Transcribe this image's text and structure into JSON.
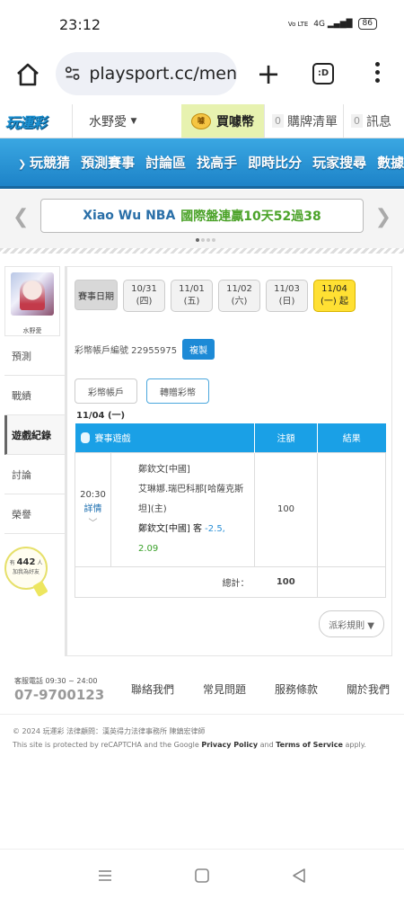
{
  "status": {
    "time": "23:12",
    "net": "Vo LTE",
    "signal": "4G",
    "battery": "86"
  },
  "browser": {
    "url": "playsport.cc/men",
    "tabs_label": ":D"
  },
  "site": {
    "logo": "玩運彩",
    "user": "水野愛",
    "buy_coin": "買噱幣",
    "coin_icon_text": "噱",
    "cart_count": "0",
    "cart_label": "購牌清單",
    "msg_count": "0",
    "msg_label": "訊息"
  },
  "nav": {
    "items": [
      "玩競猜",
      "預測賽事",
      "討論區",
      "找高手",
      "即時比分",
      "玩家搜尋",
      "數據"
    ]
  },
  "banner": {
    "left_text": "Xiao Wu NBA",
    "right_text": "國際盤連贏10天52過38"
  },
  "sidebar": {
    "username": "水野愛",
    "items": [
      "預測",
      "戰績",
      "遊戲紀錄",
      "討論",
      "榮譽"
    ],
    "hint_pre": "有",
    "hint_num": "442",
    "hint_post": "人",
    "hint_line2": "加我為好友"
  },
  "main": {
    "date_label": "賽事日期",
    "dates": [
      {
        "d": "10/31",
        "w": "(四)"
      },
      {
        "d": "11/01",
        "w": "(五)"
      },
      {
        "d": "11/02",
        "w": "(六)"
      },
      {
        "d": "11/03",
        "w": "(日)"
      },
      {
        "d": "11/04",
        "w": "(一) 起"
      }
    ],
    "account_text": "彩幣帳戶編號 22955975",
    "copy": "複製",
    "subtabs": [
      "彩幣帳戶",
      "轉贈彩幣"
    ],
    "heading": "11/04 (一)",
    "table": {
      "headers": [
        "賽事遊戲",
        "注額",
        "結果"
      ],
      "row": {
        "time": "20:30",
        "detail": "詳情",
        "line1": "鄭欽文[中國]",
        "line2": "艾琳娜.瑞巴科那[哈薩克斯坦](主)",
        "pick": "鄭欽文[中國] 客",
        "odds": "-2.5,",
        "odds2": "2.09",
        "amount": "100",
        "result": ""
      },
      "total_label": "總計：",
      "total_value": "100"
    },
    "rules": "派彩規則 ▼"
  },
  "footer": {
    "hotline_label": "客服電話 09:30 ~ 24:00",
    "hotline": "07-9700123",
    "links": [
      "聯絡我們",
      "常見問題",
      "服務條款",
      "關於我們"
    ],
    "copyright": "© 2024 玩運彩 法律顧問：漢英得力法律事務所 陳鎮宏律師",
    "recaptcha_pre": "This site is protected by reCAPTCHA and the Google",
    "privacy": "Privacy Policy",
    "and": "and",
    "terms": "Terms of Service",
    "apply": "apply."
  }
}
